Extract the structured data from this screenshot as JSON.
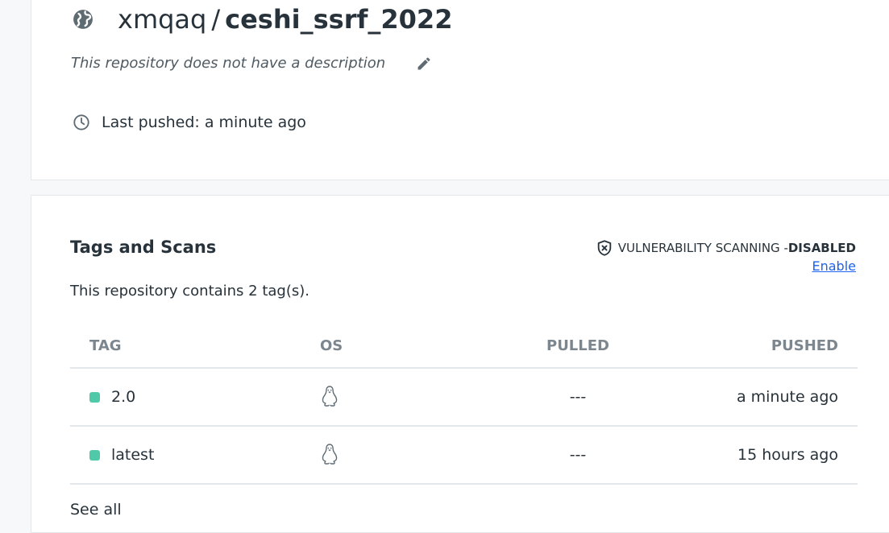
{
  "repo": {
    "owner": "xmqaq",
    "separator": "/",
    "name": "ceshi_ssrf_2022",
    "description": "This repository does not have a description",
    "last_pushed": "Last pushed: a minute ago",
    "icons": {
      "visibility": "globe-icon",
      "edit": "pencil-icon",
      "time": "clock-icon"
    }
  },
  "tags": {
    "heading": "Tags and Scans",
    "count_text": "This repository contains 2 tag(s).",
    "vulnerability": {
      "label": "VULNERABILITY SCANNING - ",
      "status": "DISABLED",
      "enable_link": "Enable",
      "icon": "shield-x-icon"
    },
    "columns": [
      "TAG",
      "OS",
      "PULLED",
      "PUSHED"
    ],
    "rows": [
      {
        "tag": "2.0",
        "os": "linux-icon",
        "pulled": "---",
        "pushed": "a minute ago"
      },
      {
        "tag": "latest",
        "os": "linux-icon",
        "pulled": "---",
        "pushed": "15 hours ago"
      }
    ],
    "see_all": "See all"
  },
  "colors": {
    "text": "#27323a",
    "muted": "#7c868e",
    "link": "#1d63ed",
    "tag_dot": "#4fc9a7",
    "border": "#e4e7ea",
    "page_bg": "#f7f8f9"
  }
}
